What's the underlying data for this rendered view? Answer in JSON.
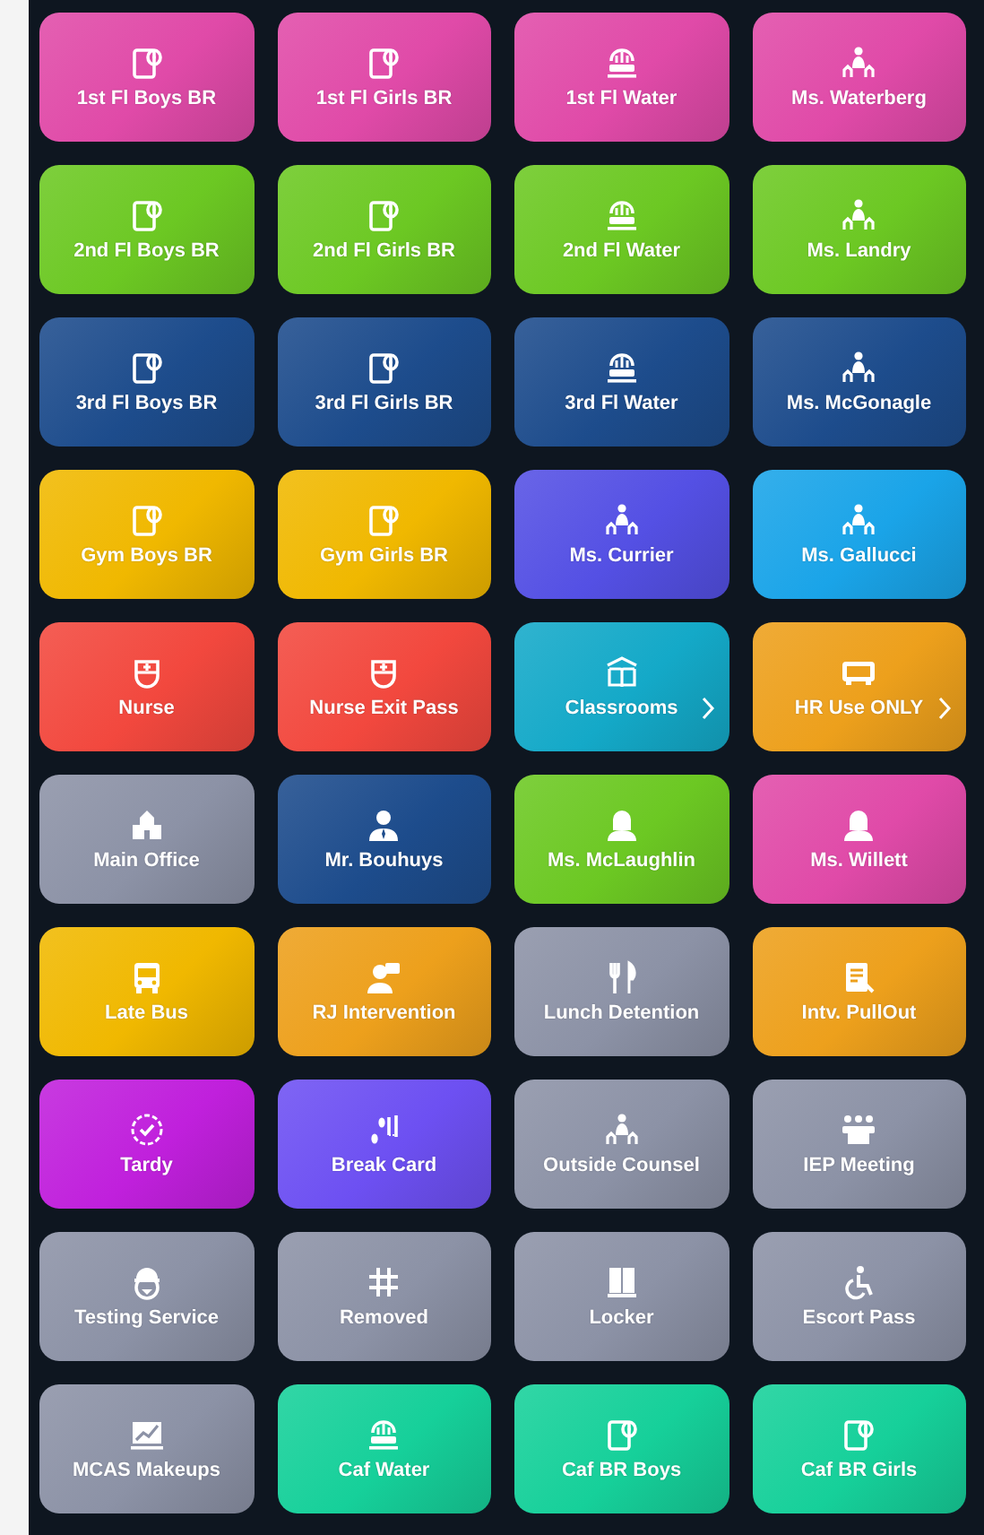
{
  "tiles": [
    {
      "label": "1st Fl Boys BR",
      "kind": "restroom",
      "color": "#e04aa8",
      "submenu": false
    },
    {
      "label": "1st Fl Girls BR",
      "kind": "restroom",
      "color": "#e04aa8",
      "submenu": false
    },
    {
      "label": "1st Fl Water",
      "kind": "water",
      "color": "#e04aa8",
      "submenu": false
    },
    {
      "label": "Ms. Waterberg",
      "kind": "counsel",
      "color": "#e04aa8",
      "submenu": false
    },
    {
      "label": "2nd Fl Boys BR",
      "kind": "restroom",
      "color": "#6cc823",
      "submenu": false
    },
    {
      "label": "2nd Fl Girls BR",
      "kind": "restroom",
      "color": "#6cc823",
      "submenu": false
    },
    {
      "label": "2nd Fl Water",
      "kind": "water",
      "color": "#6cc823",
      "submenu": false
    },
    {
      "label": "Ms. Landry",
      "kind": "counsel",
      "color": "#6cc823",
      "submenu": false
    },
    {
      "label": "3rd Fl Boys BR",
      "kind": "restroom",
      "color": "#1d4c8c",
      "submenu": false
    },
    {
      "label": "3rd Fl Girls BR",
      "kind": "restroom",
      "color": "#1d4c8c",
      "submenu": false
    },
    {
      "label": "3rd Fl Water",
      "kind": "water",
      "color": "#1d4c8c",
      "submenu": false
    },
    {
      "label": "Ms. McGonagle",
      "kind": "counsel",
      "color": "#1d4c8c",
      "submenu": false
    },
    {
      "label": "Gym Boys BR",
      "kind": "restroom",
      "color": "#f0b800",
      "submenu": false
    },
    {
      "label": "Gym Girls BR",
      "kind": "restroom",
      "color": "#f0b800",
      "submenu": false
    },
    {
      "label": "Ms. Currier",
      "kind": "counsel",
      "color": "#5450e4",
      "submenu": false
    },
    {
      "label": "Ms. Gallucci",
      "kind": "counsel",
      "color": "#1aa4e8",
      "submenu": false
    },
    {
      "label": "Nurse",
      "kind": "nurse",
      "color": "#f2483e",
      "submenu": false
    },
    {
      "label": "Nurse Exit Pass",
      "kind": "nurse",
      "color": "#f2483e",
      "submenu": false
    },
    {
      "label": "Classrooms",
      "kind": "classroom",
      "color": "#14a9c8",
      "submenu": true
    },
    {
      "label": "HR Use ONLY",
      "kind": "clock",
      "color": "#eda01c",
      "submenu": true
    },
    {
      "label": "Main Office",
      "kind": "office",
      "color": "#8c92a6",
      "submenu": false
    },
    {
      "label": "Mr. Bouhuys",
      "kind": "man",
      "color": "#1d4c8c",
      "submenu": false
    },
    {
      "label": "Ms. McLaughlin",
      "kind": "woman",
      "color": "#6cc823",
      "submenu": false
    },
    {
      "label": "Ms. Willett",
      "kind": "woman",
      "color": "#e04aa8",
      "submenu": false
    },
    {
      "label": "Late Bus",
      "kind": "bus",
      "color": "#f0b800",
      "submenu": false
    },
    {
      "label": "RJ Intervention",
      "kind": "speaker",
      "color": "#eda01c",
      "submenu": false
    },
    {
      "label": "Lunch Detention",
      "kind": "lunch",
      "color": "#8c92a6",
      "submenu": false
    },
    {
      "label": "Intv. PullOut",
      "kind": "report",
      "color": "#eda01c",
      "submenu": false
    },
    {
      "label": "Tardy",
      "kind": "tardy",
      "color": "#c020dc",
      "submenu": false
    },
    {
      "label": "Break Card",
      "kind": "steps",
      "color": "#6d50f2",
      "submenu": false
    },
    {
      "label": "Outside Counsel",
      "kind": "counsel",
      "color": "#8c92a6",
      "submenu": false
    },
    {
      "label": "IEP Meeting",
      "kind": "meeting",
      "color": "#8c92a6",
      "submenu": false
    },
    {
      "label": "Testing Service",
      "kind": "helmet",
      "color": "#8c92a6",
      "submenu": false
    },
    {
      "label": "Removed",
      "kind": "hash",
      "color": "#8c92a6",
      "submenu": false
    },
    {
      "label": "Locker",
      "kind": "locker",
      "color": "#8c92a6",
      "submenu": false
    },
    {
      "label": "Escort Pass",
      "kind": "wheelchair",
      "color": "#8c92a6",
      "submenu": false
    },
    {
      "label": "MCAS Makeups",
      "kind": "chart",
      "color": "#8c92a6",
      "submenu": false
    },
    {
      "label": "Caf Water",
      "kind": "water",
      "color": "#16d09a",
      "submenu": false
    },
    {
      "label": "Caf BR Boys",
      "kind": "restroom",
      "color": "#16d09a",
      "submenu": false
    },
    {
      "label": "Caf BR Girls",
      "kind": "restroom",
      "color": "#16d09a",
      "submenu": false
    }
  ]
}
